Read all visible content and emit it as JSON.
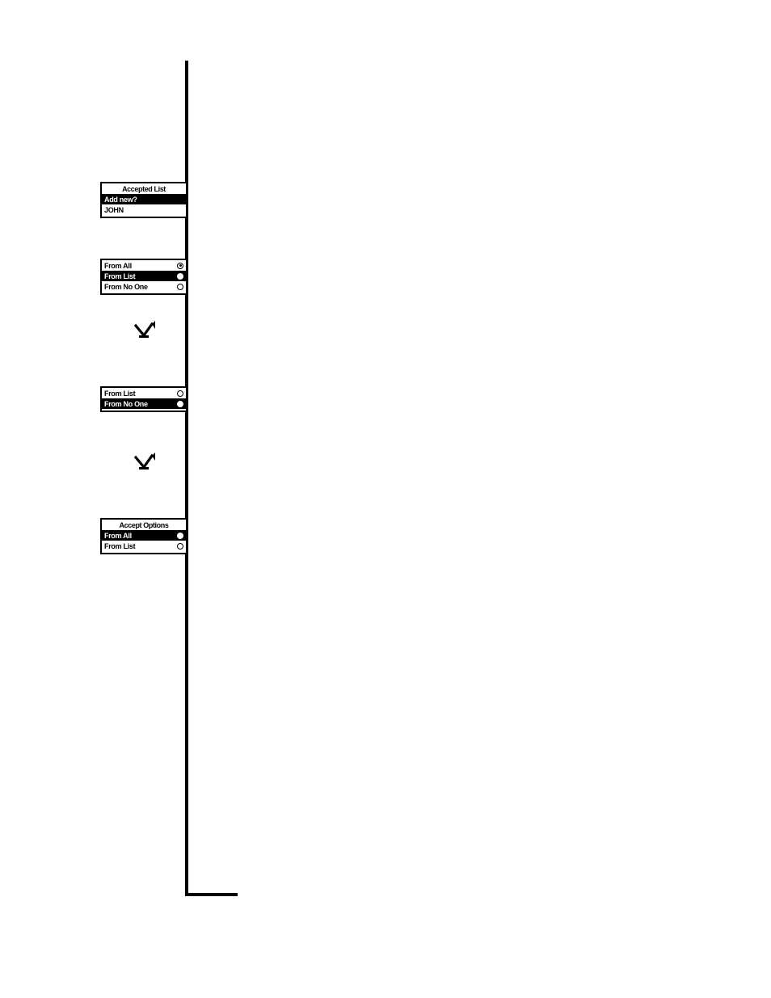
{
  "screens": {
    "accepted_list": {
      "title": "Accepted List",
      "rows": [
        {
          "label": "Add new?",
          "selected": true
        },
        {
          "label": "JOHN",
          "selected": false
        }
      ]
    },
    "accept_options_three": {
      "rows": [
        {
          "label": "From All",
          "dot": true,
          "selected": false
        },
        {
          "label": "From List",
          "dot": false,
          "selected": true
        },
        {
          "label": "From No One",
          "dot": false,
          "selected": false
        }
      ]
    },
    "accept_options_two": {
      "rows": [
        {
          "label": "From List",
          "dot": false,
          "selected": false
        },
        {
          "label": "From No One",
          "dot": true,
          "selected": true
        }
      ]
    },
    "accept_options_titled": {
      "title": "Accept Options",
      "rows": [
        {
          "label": "From All",
          "dot": true,
          "selected": true
        },
        {
          "label": "From List",
          "dot": false,
          "selected": false
        }
      ]
    }
  }
}
